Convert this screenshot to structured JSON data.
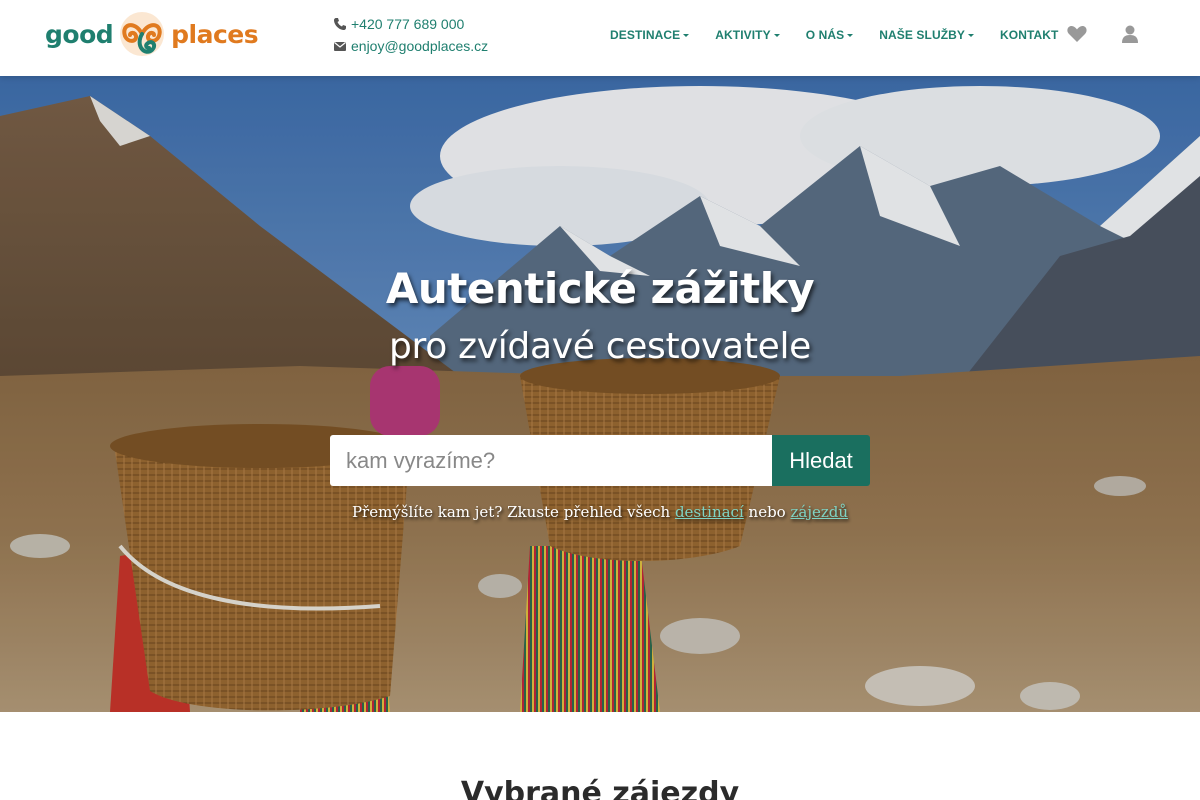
{
  "brand": {
    "logo_left": "good",
    "logo_right": "places",
    "colors": {
      "primary": "#1f7f6f",
      "accent": "#e07a1f",
      "button": "#1a6f5f"
    }
  },
  "contact": {
    "phone": "+420 777 689 000",
    "email": "enjoy@goodplaces.cz",
    "phone_icon": "phone-icon",
    "email_icon": "envelope-icon"
  },
  "nav": {
    "items": [
      {
        "label": "DESTINACE",
        "dropdown": true
      },
      {
        "label": "AKTIVITY",
        "dropdown": true
      },
      {
        "label": "O NÁS",
        "dropdown": true
      },
      {
        "label": "NAŠE SLUŽBY",
        "dropdown": true
      },
      {
        "label": "KONTAKT",
        "dropdown": false
      }
    ],
    "icons": [
      "heart-icon",
      "user-icon"
    ]
  },
  "hero": {
    "title": "Autentické zážitky",
    "subtitle": "pro zvídavé cestovatele",
    "search": {
      "placeholder": "kam vyrazíme?",
      "button_label": "Hledat"
    },
    "hint": {
      "prefix": "Přemýšlíte kam jet? Zkuste přehled všech",
      "link1": "destinací",
      "middle": "nebo",
      "link2": "zájezdů"
    }
  },
  "section": {
    "title": "Vybrané zájezdy"
  }
}
